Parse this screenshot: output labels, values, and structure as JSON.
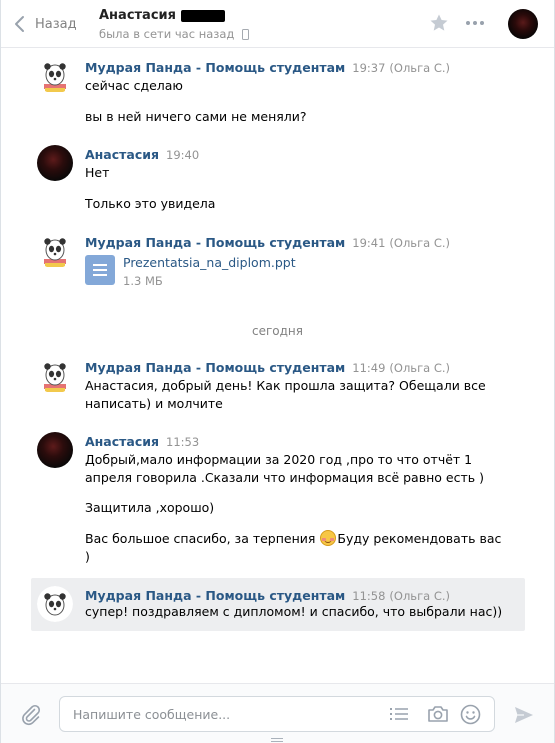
{
  "header": {
    "back_label": "Назад",
    "peer_name": "Анастасия",
    "peer_status": "была в сети час назад"
  },
  "messages": [
    {
      "author": "Мудрая Панда - Помощь студентам",
      "time": "19:37",
      "sender_note": "(Ольга С.)",
      "lines": [
        "сейчас сделаю",
        "вы в ней ничего сами не меняли?"
      ]
    },
    {
      "author": "Анастасия",
      "time": "19:40",
      "lines": [
        "Нет",
        "Только это увидела"
      ]
    },
    {
      "author": "Мудрая Панда - Помощь студентам",
      "time": "19:41",
      "sender_note": "(Ольга С.)",
      "attachment": {
        "name": "Prezentatsia_na_diplom.ppt",
        "size": "1.3 МБ",
        "icon": "document-icon"
      }
    },
    {
      "author": "Мудрая Панда - Помощь студентам",
      "time": "11:49",
      "sender_note": "(Ольга С.)",
      "lines": [
        "Анастасия, добрый день! Как прошла защита? Обещали все",
        "написать) и молчите"
      ]
    },
    {
      "author": "Анастасия",
      "time": "11:53",
      "lines": [
        "Добрый,мало информации за 2020 год ,про то что отчёт 1",
        "апреля говорила .Сказали что информация всё равно есть )",
        "Защитила ,хорошо)",
        "Вас большое спасибо, за терпения",
        "Буду рекомендовать вас",
        ")"
      ]
    },
    {
      "author": "Мудрая Панда - Помощь студентам",
      "time": "11:58",
      "sender_note": "(Ольга С.)",
      "lines": [
        "супер! поздравляем с дипломом! и спасибо, что выбрали нас))"
      ]
    }
  ],
  "date_separator": "сегодня",
  "composer": {
    "placeholder": "Напишите сообщение..."
  },
  "colors": {
    "link": "#2a5885",
    "muted": "#939393",
    "highlight_bg": "#edeef0"
  }
}
